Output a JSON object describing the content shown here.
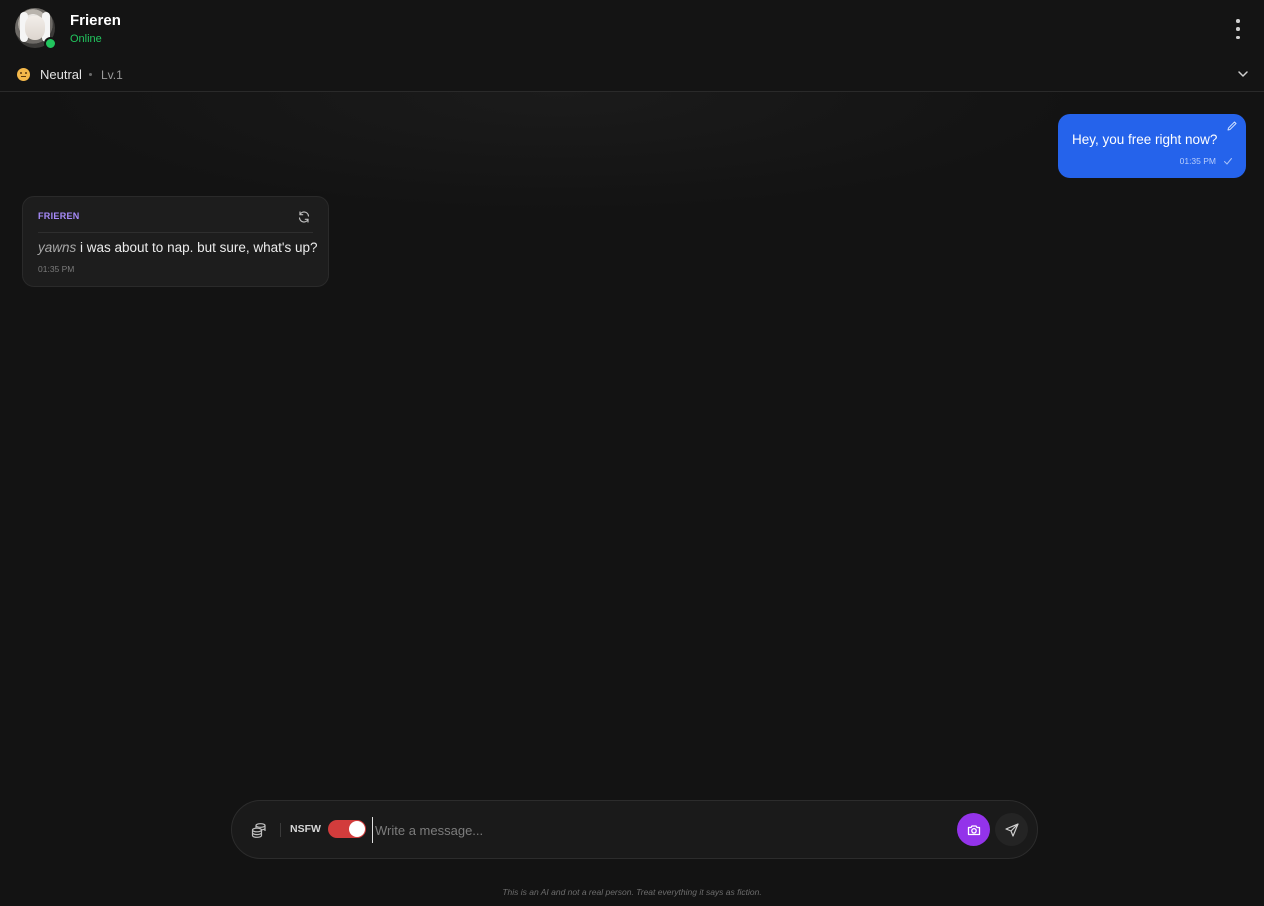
{
  "header": {
    "character_name": "Frieren",
    "status": "Online",
    "menu_icon": "more-vertical-icon"
  },
  "mood": {
    "emoji": "neutral-face-icon",
    "label": "Neutral",
    "level": "Lv.1",
    "expand_icon": "chevron-down-icon"
  },
  "messages": [
    {
      "role": "user",
      "text": "Hey, you free right now?",
      "time": "01:35 PM",
      "edit_icon": "pencil-icon",
      "read_icon": "check-icon"
    },
    {
      "role": "ai",
      "sender": "FRIEREN",
      "action": "yawns",
      "text": " i was about to nap. but sure, what's up?",
      "time": "01:35 PM",
      "regenerate_icon": "refresh-icon"
    }
  ],
  "composer": {
    "coins_icon": "coins-icon",
    "nsfw_label": "NSFW",
    "nsfw_enabled": true,
    "placeholder": "Write a message...",
    "value": "",
    "camera_icon": "camera-icon",
    "send_icon": "send-icon"
  },
  "disclaimer": "This is an AI and not a real person. Treat everything it says as fiction.",
  "colors": {
    "background": "#131313",
    "user_bubble": "#2563eb",
    "ai_bubble": "#1d1d1d",
    "online": "#22c55e",
    "sender_name": "#a78bfa",
    "toggle_on": "#d23c3c",
    "camera_button": "#9333ea"
  }
}
